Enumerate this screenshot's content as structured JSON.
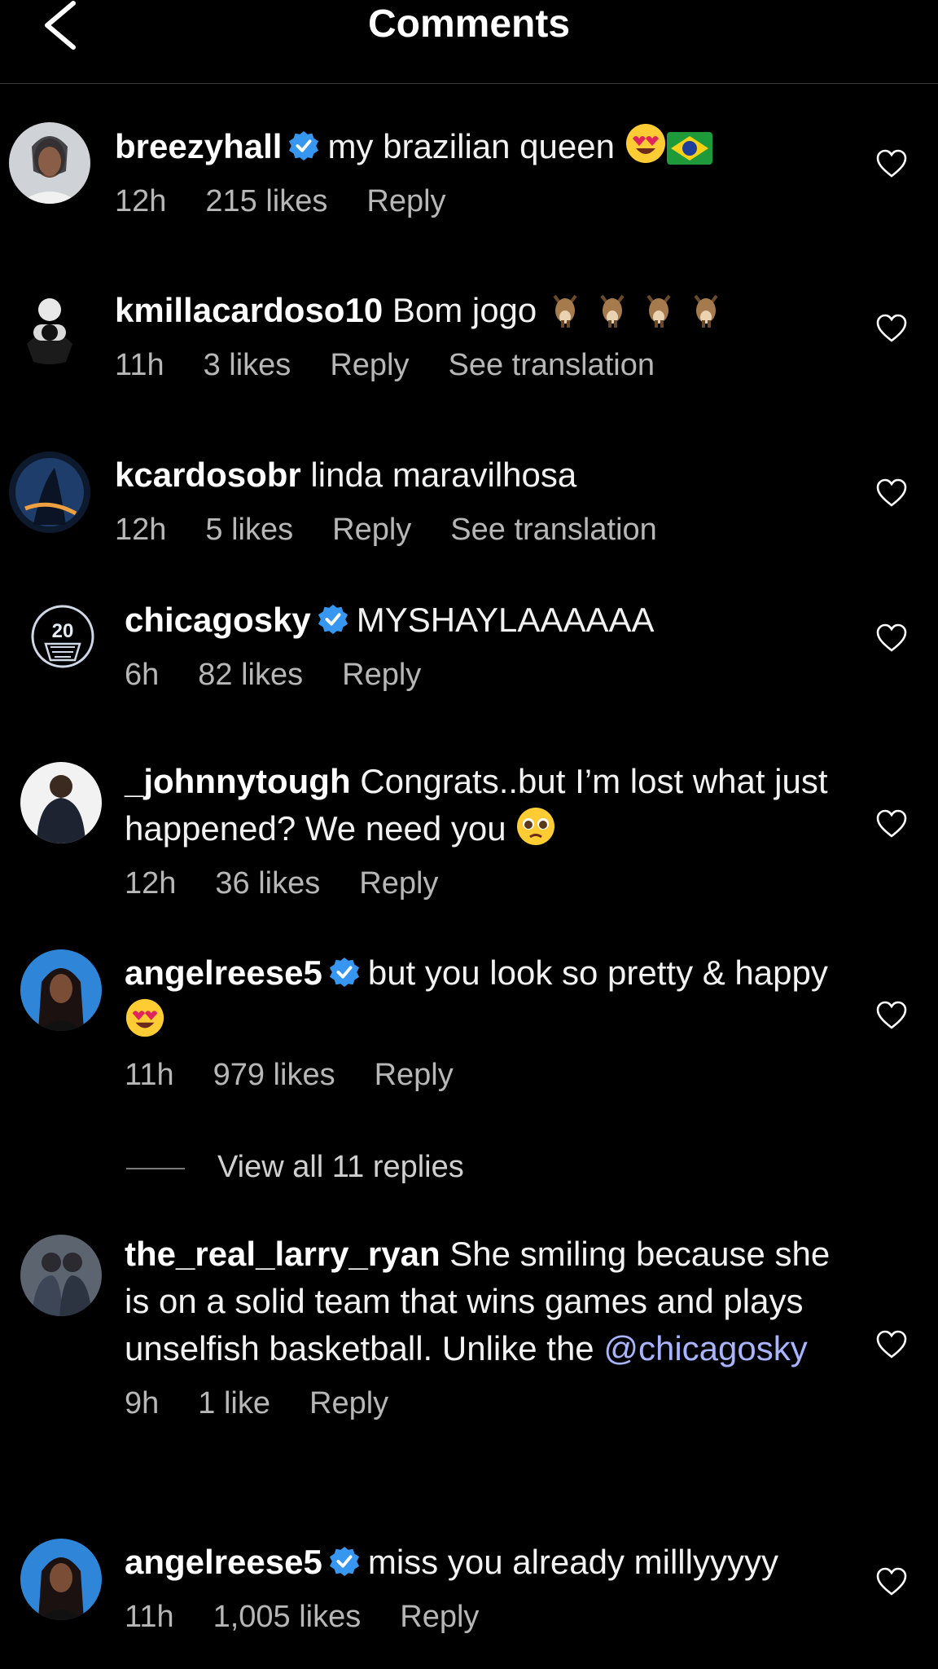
{
  "header": {
    "title": "Comments"
  },
  "comments": [
    {
      "username": "breezyhall",
      "verified": true,
      "text": "my brazilian queen",
      "time": "12h",
      "likes": "215 likes",
      "reply": "Reply"
    },
    {
      "username": "kmillacardoso10",
      "verified": false,
      "text": "Bom jogo",
      "time": "11h",
      "likes": "3 likes",
      "reply": "Reply",
      "translate": "See translation"
    },
    {
      "username": "kcardosobr",
      "verified": false,
      "text": "linda maravilhosa",
      "time": "12h",
      "likes": "5 likes",
      "reply": "Reply",
      "translate": "See translation"
    },
    {
      "username": "chicagosky",
      "verified": true,
      "text": "MYSHAYLAAAAAA",
      "time": "6h",
      "likes": "82 likes",
      "reply": "Reply"
    },
    {
      "username": "_johnnytough",
      "verified": false,
      "text": "Congrats..but I’m lost what just happened? We need you",
      "time": "12h",
      "likes": "36 likes",
      "reply": "Reply"
    },
    {
      "username": "angelreese5",
      "verified": true,
      "text": "but you look so pretty & happy",
      "time": "11h",
      "likes": "979 likes",
      "reply": "Reply"
    },
    {
      "username": "the_real_larry_ryan",
      "verified": false,
      "text": "She smiling because she is on a solid team that wins games and plays unselfish basketball. Unlike the",
      "mention": "@chicagosky",
      "time": "9h",
      "likes": "1 like",
      "reply": "Reply"
    },
    {
      "username": "angelreese5",
      "verified": true,
      "text": "miss you already milllyyyyy",
      "time": "11h",
      "likes": "1,005 likes",
      "reply": "Reply"
    }
  ],
  "view_replies": "View all 11 replies",
  "avatar_texts": {
    "chicagosky": "20"
  },
  "colors": {
    "background": "#000000",
    "verified": "#3797f0",
    "mention": "#a9b4ff",
    "meta": "#b7b7b7"
  },
  "icons": [
    "back-chevron-icon",
    "verified-badge-icon",
    "heart-outline-icon",
    "heart-eyes-emoji",
    "brazil-flag-emoji",
    "goat-emoji",
    "pleading-face-emoji"
  ]
}
